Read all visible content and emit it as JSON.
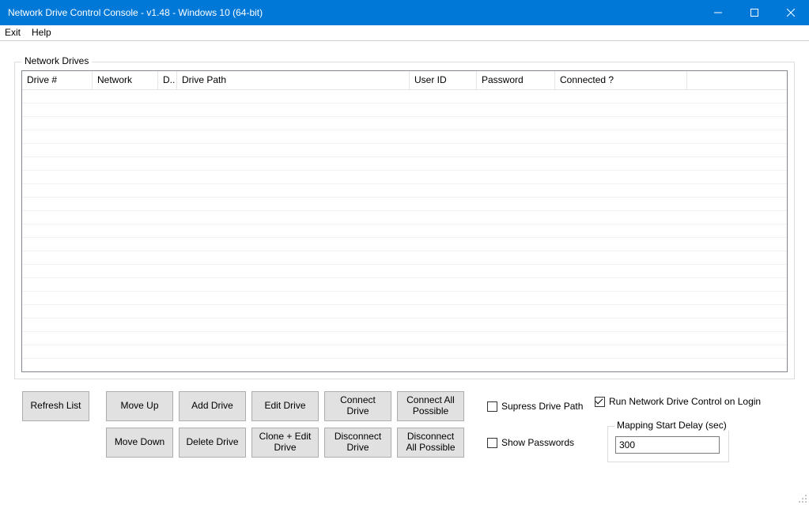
{
  "window": {
    "title": "Network Drive Control Console - v1.48 - Windows 10  (64-bit)"
  },
  "menu": {
    "exit": "Exit",
    "help": "Help"
  },
  "group": {
    "title": "Network Drives"
  },
  "columns": {
    "drive_num": "Drive #",
    "network": "Network",
    "d": "D..",
    "drive_path": "Drive Path",
    "user_id": "User ID",
    "password": "Password",
    "connected": "Connected ?"
  },
  "buttons": {
    "refresh": "Refresh List",
    "move_up": "Move Up",
    "move_down": "Move Down",
    "add_drive": "Add Drive",
    "delete_drive": "Delete Drive",
    "edit_drive": "Edit Drive",
    "clone_edit": "Clone + Edit Drive",
    "connect": "Connect Drive",
    "disconnect": "Disconnect Drive",
    "connect_all": "Connect All Possible",
    "disconnect_all": "Disconnect All Possible"
  },
  "checks": {
    "supress": "Supress Drive Path",
    "show_pw": "Show Passwords",
    "run_login": "Run Network Drive Control on Login"
  },
  "delay": {
    "label": "Mapping Start Delay (sec)",
    "value": "300"
  }
}
